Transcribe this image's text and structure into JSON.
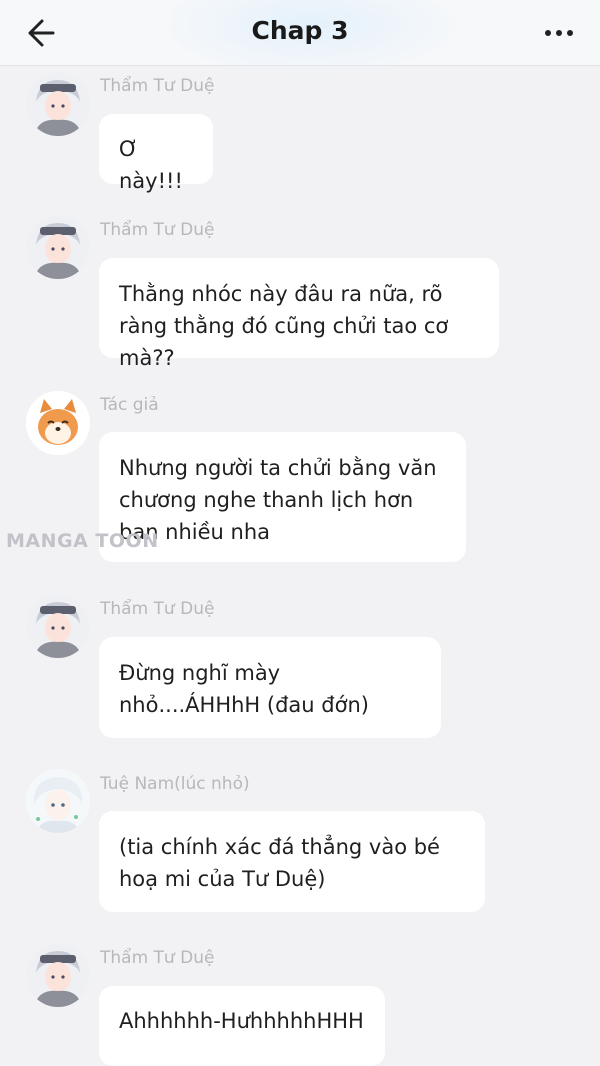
{
  "header": {
    "title": "Chap 3",
    "back_icon": "back-arrow-icon",
    "more_icon": "more-dots-icon"
  },
  "watermark": "MANGA TOON",
  "messages": [
    {
      "name": "Thẩm Tư Duệ",
      "text": "Ơ này!!!",
      "avatar": "boy-avatar"
    },
    {
      "name": "Thẩm Tư Duệ",
      "text": "Thằng nhóc này đâu ra nữa, rõ ràng thằng đó cũng chửi tao cơ mà??",
      "avatar": "boy-avatar"
    },
    {
      "name": "Tác giả",
      "text": "Nhưng người ta chửi bằng văn chương nghe thanh lịch hơn bạn nhiều nha",
      "avatar": "shiba-dog-avatar"
    },
    {
      "name": "Thẩm Tư Duệ",
      "text": "Đừng nghĩ mày nhỏ....ÁHHhH (đau đớn)",
      "avatar": "boy-avatar"
    },
    {
      "name": "Tuệ Nam(lúc nhỏ)",
      "text": "(tia chính xác đá thẳng vào bé hoạ mi của Tư Duệ)",
      "avatar": "child-avatar"
    },
    {
      "name": "Thẩm Tư Duệ",
      "text": "Ahhhhhh-HưhhhhhHHH",
      "avatar": "boy-avatar"
    }
  ]
}
